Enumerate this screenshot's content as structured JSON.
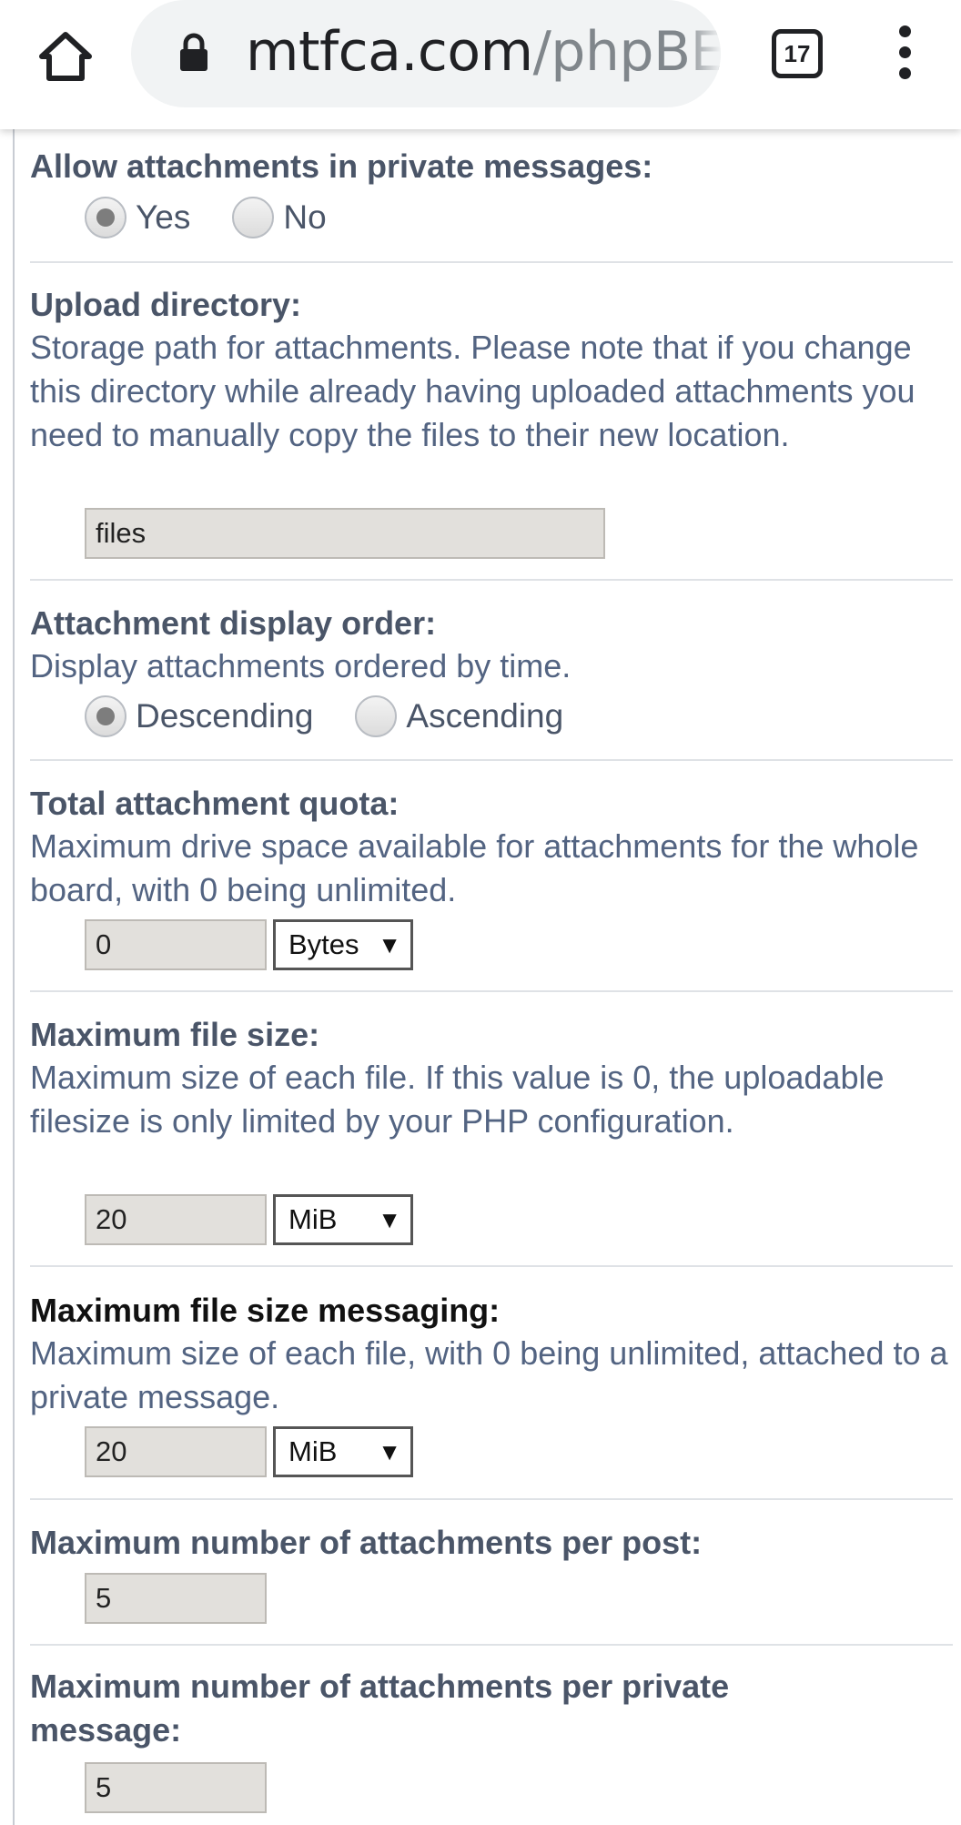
{
  "browser": {
    "url_main": "mtfca.com",
    "url_rest": "/phpBE",
    "tab_count": "17"
  },
  "settings": {
    "pm_attachments": {
      "label": "Allow attachments in private messages:",
      "options": [
        "Yes",
        "No"
      ],
      "selected": "Yes"
    },
    "upload_dir": {
      "label": "Upload directory:",
      "description": "Storage path for attachments. Please note that if you change this directory while already having uploaded attachments you need to manually copy the files to their new location.",
      "value": "files"
    },
    "display_order": {
      "label": "Attachment display order:",
      "description": "Display attachments ordered by time.",
      "options": [
        "Descending",
        "Ascending"
      ],
      "selected": "Descending"
    },
    "total_quota": {
      "label": "Total attachment quota:",
      "description": "Maximum drive space available for attachments for the whole board, with 0 being unlimited.",
      "value": "0",
      "unit": "Bytes"
    },
    "max_file_size": {
      "label": "Maximum file size:",
      "description": "Maximum size of each file. If this value is 0, the uploadable filesize is only limited by your PHP configuration.",
      "value": "20",
      "unit": "MiB"
    },
    "max_file_size_pm": {
      "label": "Maximum file size messaging:",
      "description": "Maximum size of each file, with 0 being unlimited, attached to a private message.",
      "value": "20",
      "unit": "MiB"
    },
    "max_attach_post": {
      "label": "Maximum number of attachments per post:",
      "value": "5"
    },
    "max_attach_pm": {
      "label_line1": "Maximum number of attachments per private",
      "label_line2": "message:",
      "value": "5"
    }
  }
}
